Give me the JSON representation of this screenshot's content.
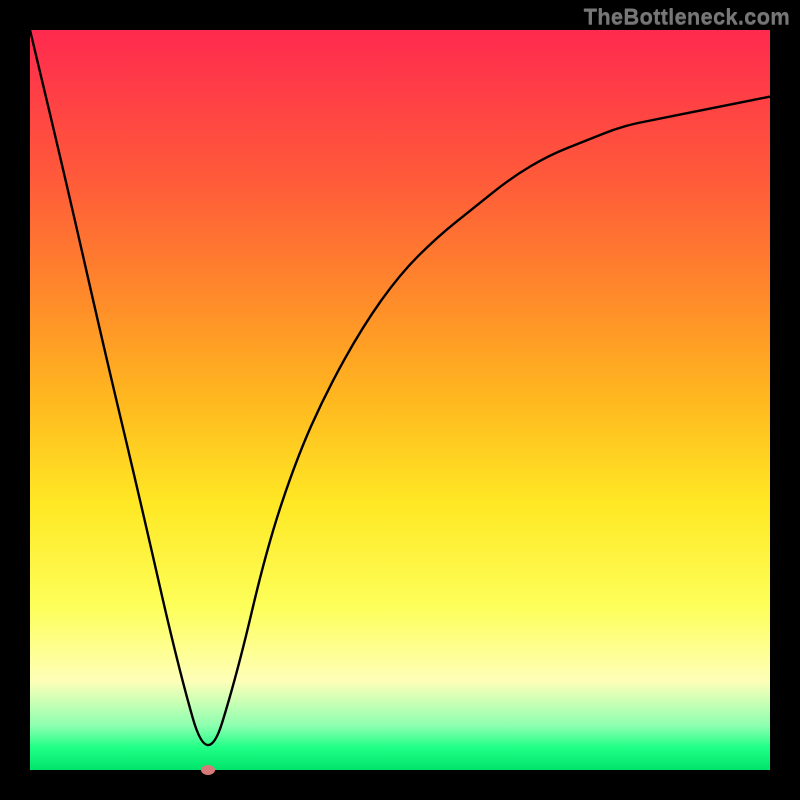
{
  "watermark": "TheBottleneck.com",
  "chart_data": {
    "type": "line",
    "x": [
      0,
      5,
      10,
      15,
      20,
      24,
      28,
      32,
      36,
      40,
      45,
      50,
      55,
      60,
      65,
      70,
      75,
      80,
      85,
      90,
      95,
      100
    ],
    "series": [
      {
        "name": "bottleneck-curve",
        "values": [
          100,
          79,
          57,
          36,
          14,
          0,
          13,
          30,
          42,
          51,
          60,
          67,
          72,
          76,
          80,
          83,
          85,
          87,
          88,
          89,
          90,
          91
        ]
      }
    ],
    "title": "",
    "xlabel": "",
    "ylabel": "",
    "xlim": [
      0,
      100
    ],
    "ylim": [
      0,
      100
    ],
    "grid": false,
    "legend": false,
    "marker": {
      "x": 24,
      "y": 0,
      "color": "#d97a7a"
    },
    "background_gradient": {
      "top": "#ff2a4f",
      "bottom": "#00e46a"
    }
  }
}
